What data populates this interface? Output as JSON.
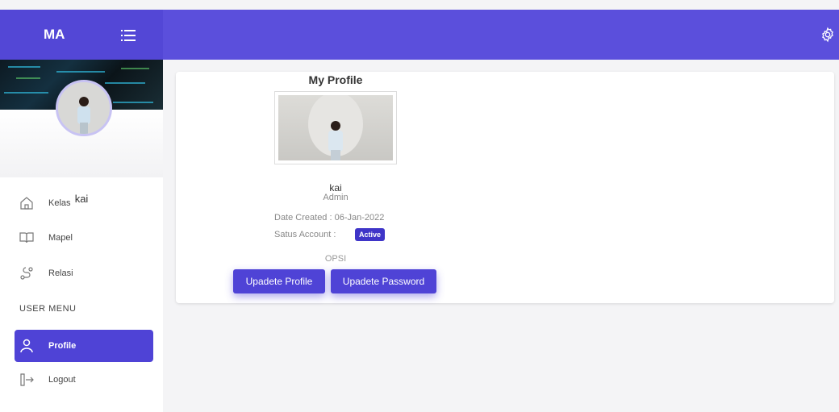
{
  "brand": {
    "title": "MA"
  },
  "user": {
    "name": "kai"
  },
  "sidebar": {
    "items": [
      {
        "label": "Kelas",
        "icon": "home-icon"
      },
      {
        "label": "Mapel",
        "icon": "book-icon"
      },
      {
        "label": "Relasi",
        "icon": "route-icon"
      }
    ],
    "section_title": "USER MENU",
    "user_items": [
      {
        "label": "Profile",
        "icon": "user-icon",
        "active": true
      },
      {
        "label": "Logout",
        "icon": "logout-icon"
      }
    ]
  },
  "profile": {
    "title": "My Profile",
    "name": "kai",
    "role": "Admin",
    "date_created": "Date Created : 06-Jan-2022",
    "status_label": "Satus Account :",
    "status_value": "Active",
    "options_label": "OPSI",
    "update_profile_label": "Upadete Profile",
    "update_password_label": "Upadete Password"
  },
  "colors": {
    "accent": "#5b4fdc",
    "badge": "#3f35c8",
    "background": "#f4f4f6"
  }
}
